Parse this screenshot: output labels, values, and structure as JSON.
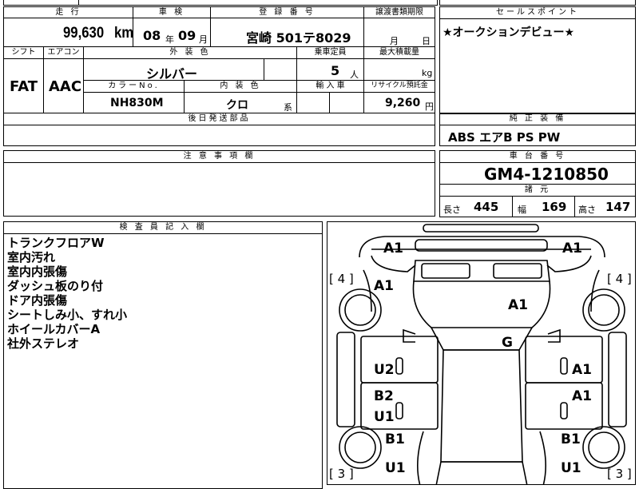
{
  "summary": {
    "mileage_label": "走 行",
    "mileage": "99,630",
    "mileage_unit": "km",
    "inspection_label": "車 検",
    "inspection_year": "08",
    "year_unit": "年",
    "inspection_month": "09",
    "month_unit": "月",
    "registration_label": "登 録 番 号",
    "registration": "宮崎 501テ8029",
    "transfer_label": "譲渡書類期限",
    "transfer_month": "月",
    "transfer_day": "日"
  },
  "selling_points": {
    "header": "セールスポイント",
    "text": "★オークションデビュー★"
  },
  "specs": {
    "shift_label": "シフト",
    "shift": "FAT",
    "ac_label": "エアコン",
    "ac": "AAC",
    "exterior_label": "外 装 色",
    "exterior": "シルバー",
    "capacity_label": "乗車定員",
    "capacity": "5",
    "capacity_unit": "人",
    "load_label": "最大積載量",
    "load_unit": "kg",
    "color_no_label": "カラーNo.",
    "color_no": "NH830M",
    "interior_label": "内 装 色",
    "interior": "クロ",
    "interior_unit": "系",
    "import_label": "輸 入 車",
    "recycle_label": "リサイクル預託金",
    "recycle": "9,260",
    "recycle_unit": "円",
    "shipping_label": "後日発送部品"
  },
  "equipment": {
    "header": "純 正 装 備",
    "text": "ABS エアB PS PW"
  },
  "notes": {
    "header": "注 意 事 項 欄"
  },
  "chassis": {
    "header": "車 台 番 号",
    "number": "GM4-1210850"
  },
  "dimensions": {
    "header": "諸 元",
    "length_label": "長さ",
    "length": "445",
    "width_label": "幅",
    "width": "169",
    "height_label": "高さ",
    "height": "147"
  },
  "inspector": {
    "header": "検 査 員 記 入 欄",
    "remarks": [
      "トランクフロアW",
      "室内汚れ",
      "室内内張傷",
      "ダッシュ板のり付",
      "ドア内張傷",
      "シートしみ小、すれ小",
      "ホイールカバーA",
      "社外ステレオ"
    ]
  },
  "diagram": {
    "marks": [
      "A1",
      "A1",
      "A1",
      "A1",
      "G",
      "U2",
      "A1",
      "B2",
      "A1",
      "U1",
      "B1",
      "B1",
      "U1",
      "U1"
    ],
    "tire_left_front": "[ 4 ]",
    "tire_right_front": "[ 4 ]",
    "tire_left_rear": "[ 3 ]",
    "tire_right_rear": "[ 3 ]"
  }
}
